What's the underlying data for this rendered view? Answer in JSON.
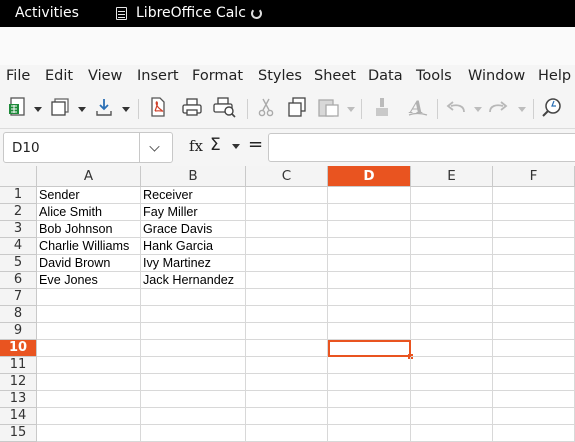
{
  "topbar": {
    "activities": "Activities",
    "app_name": "LibreOffice Calc"
  },
  "menu": [
    "File",
    "Edit",
    "View",
    "Insert",
    "Format",
    "Styles",
    "Sheet",
    "Data",
    "Tools",
    "Window",
    "Help"
  ],
  "toolbar": {
    "icons": [
      "new-spreadsheet-icon",
      "templates-icon",
      "open-icon",
      "export-pdf-icon",
      "print-icon",
      "print-preview-icon",
      "cut-icon",
      "copy-icon",
      "paste-icon",
      "clone-formatting-icon",
      "clear-formatting-icon",
      "undo-icon",
      "redo-icon",
      "find-replace-icon"
    ]
  },
  "formula_bar": {
    "name_box": "D10",
    "fx": "fx",
    "sigma": "Σ",
    "equals": "=",
    "content": ""
  },
  "sheet": {
    "columns": [
      "A",
      "B",
      "C",
      "D",
      "E",
      "F"
    ],
    "selected_column": "D",
    "rows": [
      "1",
      "2",
      "3",
      "4",
      "5",
      "6",
      "7",
      "8",
      "9",
      "10",
      "11",
      "12",
      "13",
      "14",
      "15"
    ],
    "selected_row": "10",
    "active_cell": "D10",
    "cells": [
      [
        "Sender",
        "Receiver",
        "",
        "",
        "",
        ""
      ],
      [
        "Alice Smith",
        "Fay Miller",
        "",
        "",
        "",
        ""
      ],
      [
        "Bob Johnson",
        "Grace Davis",
        "",
        "",
        "",
        ""
      ],
      [
        "Charlie Williams",
        "Hank Garcia",
        "",
        "",
        "",
        ""
      ],
      [
        "David Brown",
        "Ivy Martinez",
        "",
        "",
        "",
        ""
      ],
      [
        "Eve Jones",
        "Jack Hernandez",
        "",
        "",
        "",
        ""
      ]
    ]
  },
  "colors": {
    "accent": "#e95420",
    "topbar": "#000000"
  }
}
